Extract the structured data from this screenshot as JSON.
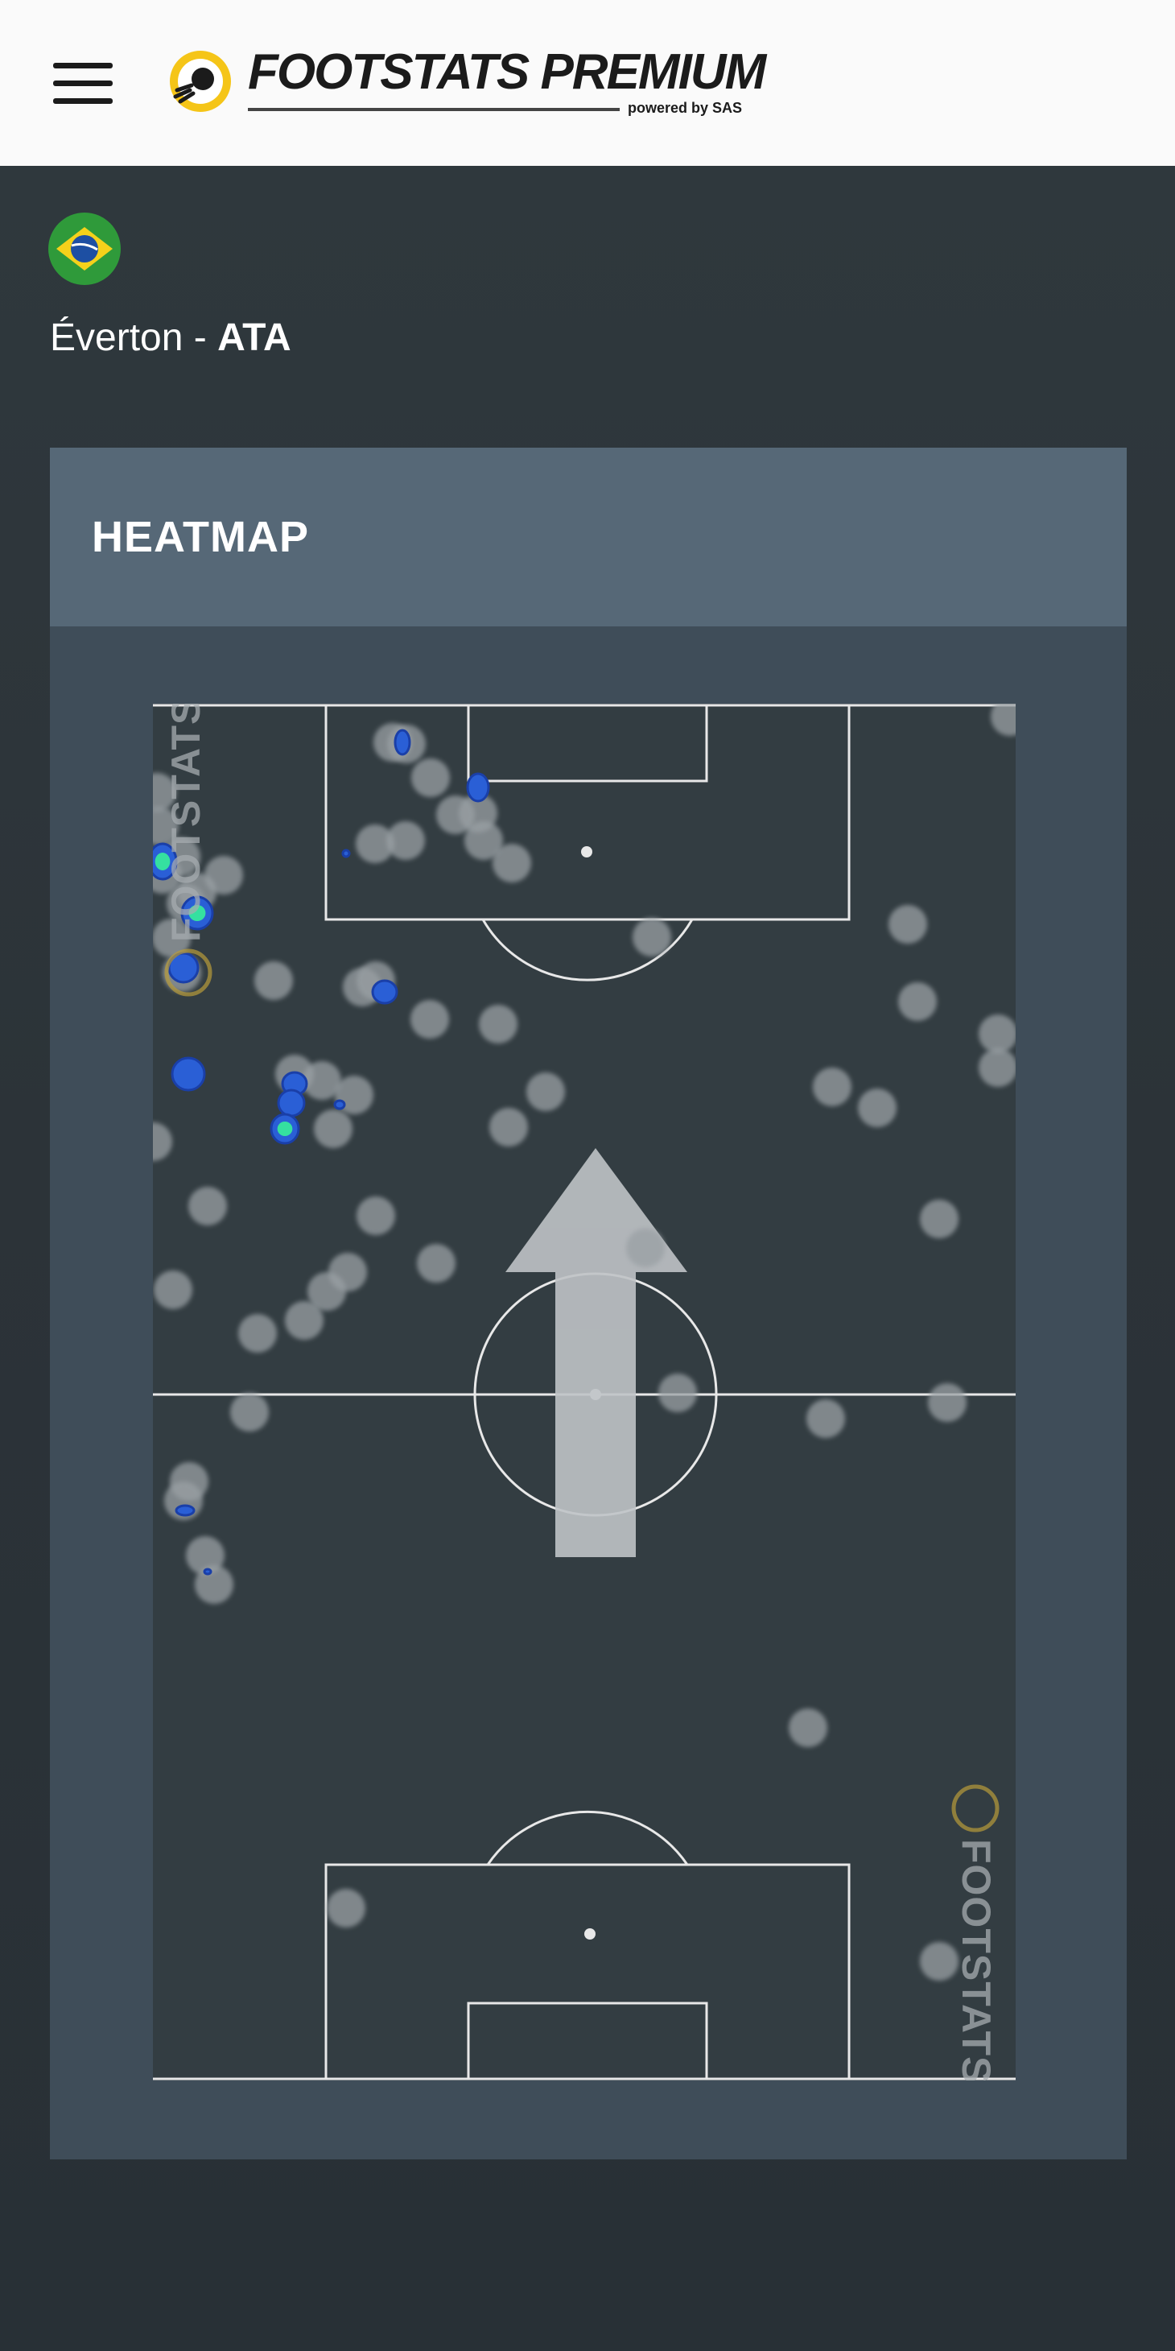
{
  "header": {
    "brand": "FOOTSTATS PREMIUM",
    "powered_by": "powered by SAS",
    "menu_icon": "hamburger-menu-icon",
    "logo_icon": "football-logo-icon"
  },
  "player": {
    "flag_icon": "brazil-flag-icon",
    "name": "Éverton",
    "separator": " - ",
    "position": "ATA"
  },
  "card": {
    "title": "HEATMAP"
  },
  "pitch": {
    "watermark_text": "FOOTSTATS",
    "direction_icon": "attack-direction-arrow-icon",
    "colors": {
      "pitch": "#333d42",
      "lines": "#e8e8e8",
      "touch": "#9aa0a4",
      "heat_low": "#2a5fd6",
      "heat_high": "#35e0a0"
    }
  }
}
